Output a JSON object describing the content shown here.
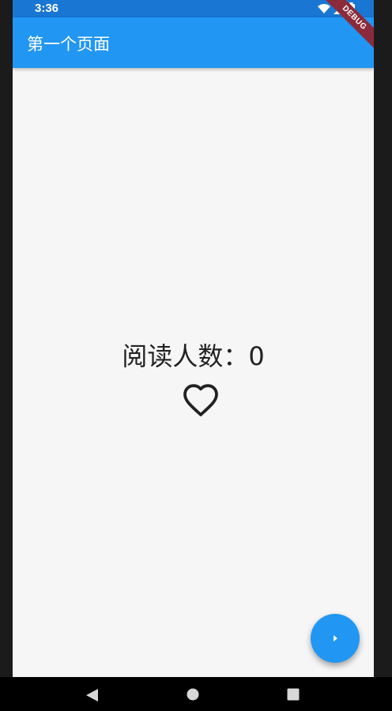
{
  "status_bar": {
    "time": "3:36",
    "icons": [
      "wifi-icon",
      "signal-icon",
      "battery-icon"
    ]
  },
  "app_bar": {
    "title": "第一个页面",
    "color": "#2196f3"
  },
  "debug_banner": {
    "label": "DEBUG",
    "color": "#8b2a3a"
  },
  "main": {
    "counter_text": "阅读人数：0",
    "heart_icon": "heart-outline-icon"
  },
  "fab": {
    "icon": "arrow-right-icon",
    "color": "#2196f3"
  },
  "nav_bar": {
    "buttons": [
      "back-icon",
      "home-icon",
      "recents-icon"
    ]
  }
}
